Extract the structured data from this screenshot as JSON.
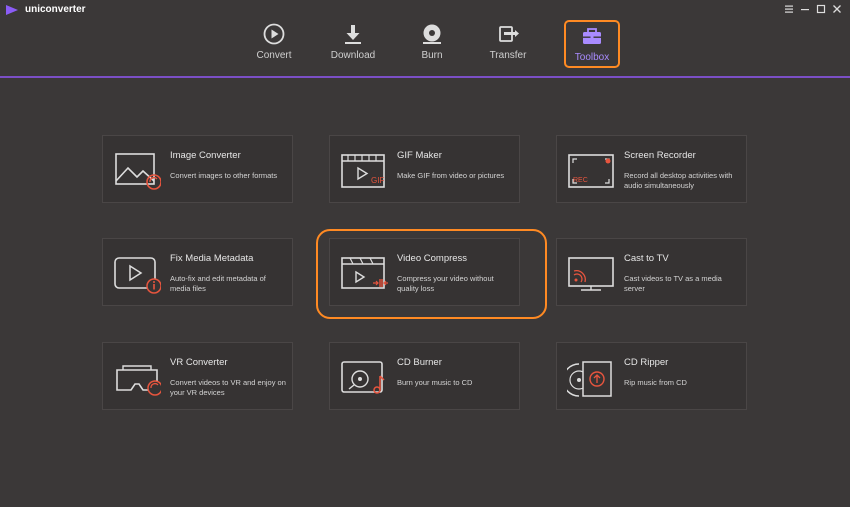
{
  "app": {
    "name": "uniconverter"
  },
  "window_controls": {
    "menu": "menu-icon",
    "minimize": "minimize-icon",
    "maximize": "maximize-icon",
    "close": "close-icon"
  },
  "nav": [
    {
      "id": "convert",
      "label": "Convert",
      "icon": "convert-icon"
    },
    {
      "id": "download",
      "label": "Download",
      "icon": "download-icon"
    },
    {
      "id": "burn",
      "label": "Burn",
      "icon": "burn-icon"
    },
    {
      "id": "transfer",
      "label": "Transfer",
      "icon": "transfer-icon"
    },
    {
      "id": "toolbox",
      "label": "Toolbox",
      "icon": "toolbox-icon",
      "active": true
    }
  ],
  "tools": [
    {
      "title": "Image Converter",
      "description": "Convert images to other formats",
      "icon": "image-converter-icon"
    },
    {
      "title": "GIF Maker",
      "description": "Make GIF from video or pictures",
      "icon": "gif-maker-icon",
      "badge": "GIF"
    },
    {
      "title": "Screen Recorder",
      "description": "Record all desktop activities with audio simultaneously",
      "icon": "screen-recorder-icon",
      "badge": "REC"
    },
    {
      "title": "Fix Media Metadata",
      "description": "Auto-fix and edit metadata of media files",
      "icon": "fix-metadata-icon"
    },
    {
      "title": "Video Compress",
      "description": "Compress your video without quality loss",
      "icon": "video-compress-icon",
      "highlighted": true
    },
    {
      "title": "Cast to TV",
      "description": "Cast videos to TV as a media server",
      "icon": "cast-to-tv-icon"
    },
    {
      "title": "VR Converter",
      "description": "Convert videos to VR and enjoy on your VR devices",
      "icon": "vr-converter-icon"
    },
    {
      "title": "CD Burner",
      "description": "Burn your music to CD",
      "icon": "cd-burner-icon"
    },
    {
      "title": "CD Ripper",
      "description": "Rip music from CD",
      "icon": "cd-ripper-icon"
    }
  ],
  "colors": {
    "background": "#3b3838",
    "card": "#363333",
    "accent_orange": "#ff8a23",
    "accent_purple": "#7b4fc6",
    "icon_red": "#e8553e"
  }
}
